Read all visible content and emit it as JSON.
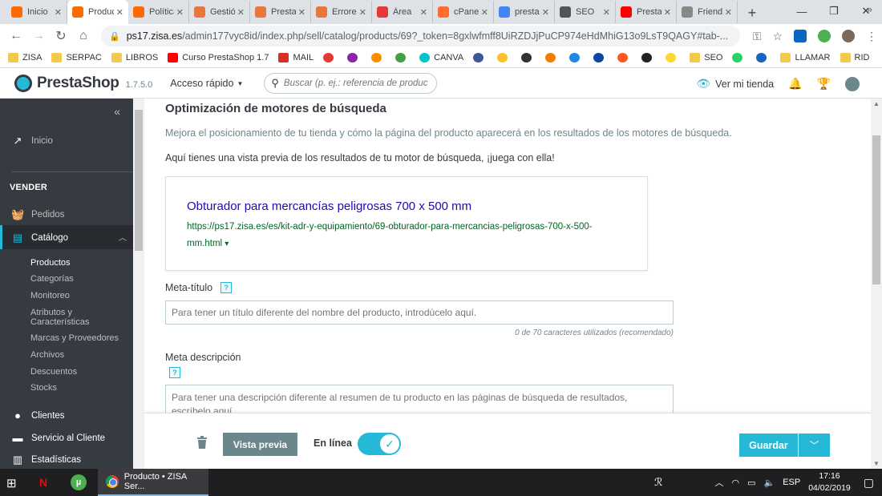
{
  "browser": {
    "tabs": [
      {
        "label": "Inicio",
        "color": "#ff6a00"
      },
      {
        "label": "Producto",
        "color": "#ff6a00",
        "active": true
      },
      {
        "label": "Política",
        "color": "#ff6a00"
      },
      {
        "label": "Gestión",
        "color": "#e8773e"
      },
      {
        "label": "PrestaShop",
        "color": "#e8773e"
      },
      {
        "label": "Errores",
        "color": "#e8773e"
      },
      {
        "label": "Área",
        "color": "#e53935"
      },
      {
        "label": "cPanel",
        "color": "#ff6c2c"
      },
      {
        "label": "prestashop",
        "color": "#4285f4"
      },
      {
        "label": "SEO",
        "color": "#555555"
      },
      {
        "label": "PrestaShop",
        "color": "#ff0000"
      },
      {
        "label": "Friendly",
        "color": "#888888"
      }
    ],
    "new_tab": "+",
    "url_host": "ps17.zisa.es",
    "url_path": "/admin177vyc8id/index.php/sell/catalog/products/69?_token=8gxlwfmff8UiRZDJjPuCP974eHdMhiG13o9LsT9QAGY#tab-...",
    "bookmarks": [
      {
        "label": "ZISA",
        "type": "folder"
      },
      {
        "label": "SERPAC",
        "type": "folder"
      },
      {
        "label": "LIBROS",
        "type": "folder"
      },
      {
        "label": "Curso PrestaShop 1.7",
        "type": "youtube"
      },
      {
        "label": "MAIL",
        "type": "gmail"
      },
      {
        "label": "",
        "type": "icon",
        "color": "#e53935"
      },
      {
        "label": "",
        "type": "icon",
        "color": "#8e24aa"
      },
      {
        "label": "",
        "type": "icon",
        "color": "#fb8c00"
      },
      {
        "label": "",
        "type": "icon",
        "color": "#43a047"
      },
      {
        "label": "CANVA",
        "type": "canva"
      },
      {
        "label": "",
        "type": "icon",
        "color": "#3b5998"
      },
      {
        "label": "",
        "type": "icon",
        "color": "#fbc02d"
      },
      {
        "label": "",
        "type": "icon",
        "color": "#333333"
      },
      {
        "label": "",
        "type": "icon",
        "color": "#f57c00"
      },
      {
        "label": "",
        "type": "icon",
        "color": "#1e88e5"
      },
      {
        "label": "",
        "type": "icon",
        "color": "#0d47a1"
      },
      {
        "label": "",
        "type": "icon",
        "color": "#ff5722"
      },
      {
        "label": "",
        "type": "icon",
        "color": "#212121"
      },
      {
        "label": "",
        "type": "icon",
        "color": "#fdd835"
      },
      {
        "label": "SEO",
        "type": "folder"
      },
      {
        "label": "",
        "type": "icon",
        "color": "#25d366"
      },
      {
        "label": "",
        "type": "icon",
        "color": "#1565c0"
      },
      {
        "label": "LLAMAR",
        "type": "folder"
      },
      {
        "label": "RID",
        "type": "folder"
      }
    ],
    "bookmarks_more": "»"
  },
  "header": {
    "logo_text": "PrestaShop",
    "version": "1.7.5.0",
    "quick_access": "Acceso rápido",
    "search_placeholder": "Buscar (p. ej.: referencia de producto, no",
    "view_shop": "Ver mi tienda"
  },
  "sidebar": {
    "collapse": "«",
    "home": "Inicio",
    "section": "VENDER",
    "orders": "Pedidos",
    "catalog": "Catálogo",
    "catalog_sub": [
      "Productos",
      "Categorías",
      "Monitoreo",
      "Atributos y Características",
      "Marcas y Proveedores",
      "Archivos",
      "Descuentos",
      "Stocks"
    ],
    "customers": "Clientes",
    "customer_service": "Servicio al Cliente",
    "stats": "Estadísticas"
  },
  "seo": {
    "title": "Optimización de motores de búsqueda",
    "description": "Mejora el posicionamiento de tu tienda y cómo la página del producto aparecerá en los resultados de los motores de búsqueda.",
    "preview_intro": "Aquí tienes una vista previa de los resultados de tu motor de búsqueda, ¡juega con ella!",
    "serp_title": "Obturador para mercancías peligrosas 700 x 500 mm",
    "serp_url": "https://ps17.zisa.es/es/kit-adr-y-equipamiento/69-obturador-para-mercancias-peligrosas-700-x-500-mm.html",
    "serp_caret": "▾",
    "meta_title_label": "Meta-título",
    "meta_title_placeholder": "Para tener un título diferente del nombre del producto, introdúcelo aquí.",
    "meta_title_counter": "0 de 70 caracteres utilizados (recomendado)",
    "meta_desc_label": "Meta descripción",
    "meta_desc_placeholder": "Para tener una descripción diferente al resumen de tu producto en las páginas de búsqueda de resultados, escríbelo aquí.",
    "help": "?"
  },
  "footer": {
    "preview_button": "Vista previa",
    "online_label": "En línea",
    "online": true,
    "save_button": "Guardar"
  },
  "taskbar": {
    "chrome_window": "Producto • ZISA Ser...",
    "language": "ESP",
    "time": "17:16",
    "date": "04/02/2019"
  },
  "colors": {
    "accent": "#25b9d7",
    "sidebar": "#363a41",
    "serp_title": "#1a0dab",
    "serp_url": "#006621"
  }
}
